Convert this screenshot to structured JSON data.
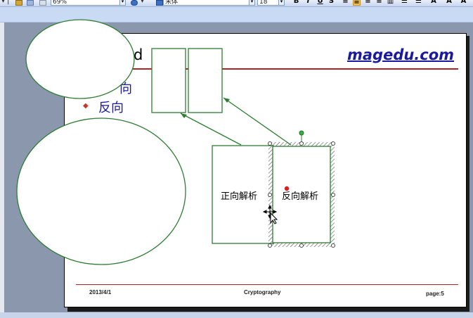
{
  "toolbar": {
    "zoom_value": "69%",
    "font_name": "宋体",
    "font_size": "18",
    "bold_label": "B",
    "italic_label": "I",
    "underline_label": "U",
    "shadow_label": "S",
    "font_color_label": "A"
  },
  "slide": {
    "brand": "magedu.com",
    "title_fragment": "d",
    "bullets": [
      "向",
      "反向"
    ],
    "footer": {
      "date": "2013/4/1",
      "center": "Cryptography",
      "page": "page:5"
    }
  },
  "diagram": {
    "forward_label": "正向解析",
    "reverse_label": "反向解析"
  },
  "colors": {
    "shape_stroke": "#2e7d32",
    "rule": "#b32222",
    "brand": "#1a1aa0"
  }
}
